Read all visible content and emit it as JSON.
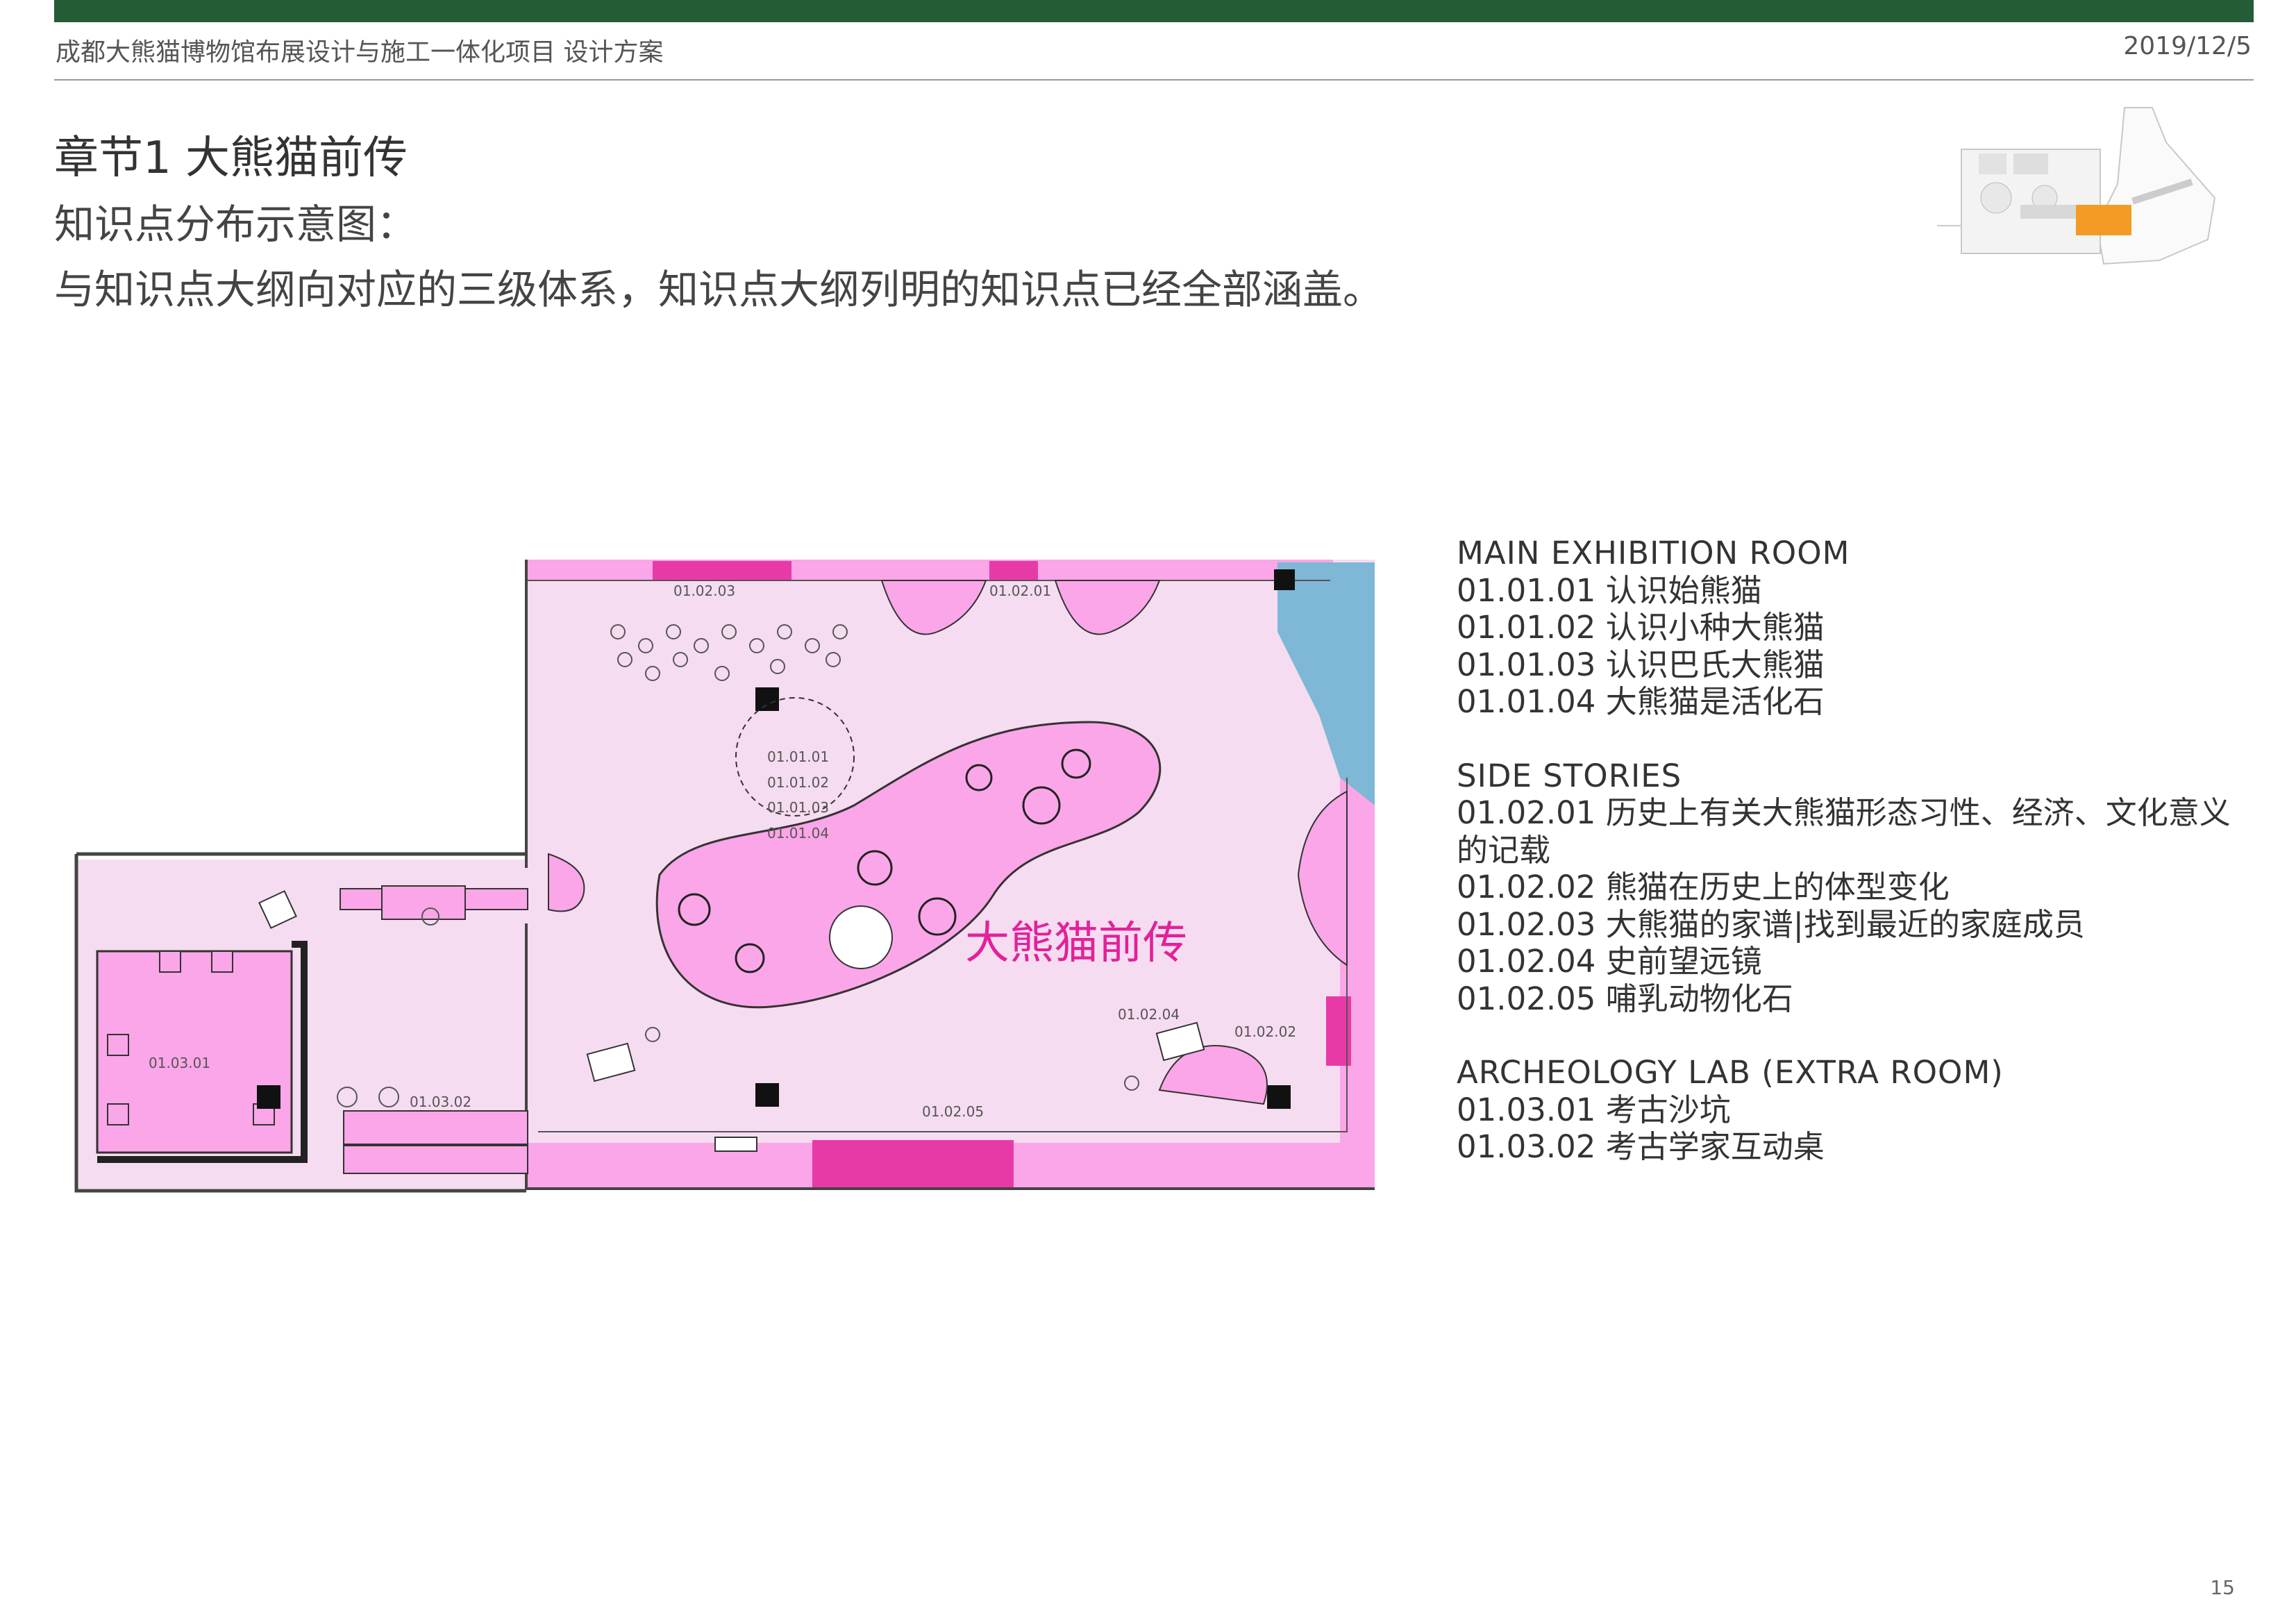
{
  "header": {
    "project_title": "成都大熊猫博物馆布展设计与施工一体化项目  设计方案",
    "date": "2019/12/5"
  },
  "chapter_title": "章节1 大熊猫前传",
  "subtitle": "知识点分布示意图：",
  "description": "与知识点大纲向对应的三级体系，知识点大纲列明的知识点已经全部涵盖。",
  "floorplan": {
    "zone_title": "大熊猫前传",
    "labels": {
      "k010203": "01.02.03",
      "k010201": "01.02.01",
      "k010101": "01.01.01",
      "k010102": "01.01.02",
      "k010103": "01.01.03",
      "k010104": "01.01.04",
      "k010204": "01.02.04",
      "k010202": "01.02.02",
      "k010205": "01.02.05",
      "k010301": "01.03.01",
      "k010302": "01.03.02"
    },
    "colors": {
      "light_pink": "#f6dcf0",
      "pink": "#fba6e8",
      "magenta": "#e83aa6",
      "blue": "#7fb7d6",
      "zone_text": "#e2219a"
    }
  },
  "legend": {
    "sections": [
      {
        "heading": "MAIN EXHIBITION ROOM",
        "items": [
          "01.01.01  认识始熊猫",
          "01.01.02  认识小种大熊猫",
          "01.01.03  认识巴氏大熊猫",
          "01.01.04  大熊猫是活化石"
        ]
      },
      {
        "heading": "SIDE STORIES",
        "items": [
          "01.02.01  历史上有关大熊猫形态习性、经济、文化意义的记载",
          "01.02.02  熊猫在历史上的体型变化",
          "01.02.03 大熊猫的家谱|找到最近的家庭成员",
          "01.02.04 史前望远镜",
          "01.02.05 哺乳动物化石"
        ]
      },
      {
        "heading": "ARCHEOLOGY LAB (EXTRA ROOM)",
        "items": [
          "01.03.01  考古沙坑",
          "01.03.02  考古学家互动桌"
        ]
      }
    ]
  },
  "page_number": "15"
}
